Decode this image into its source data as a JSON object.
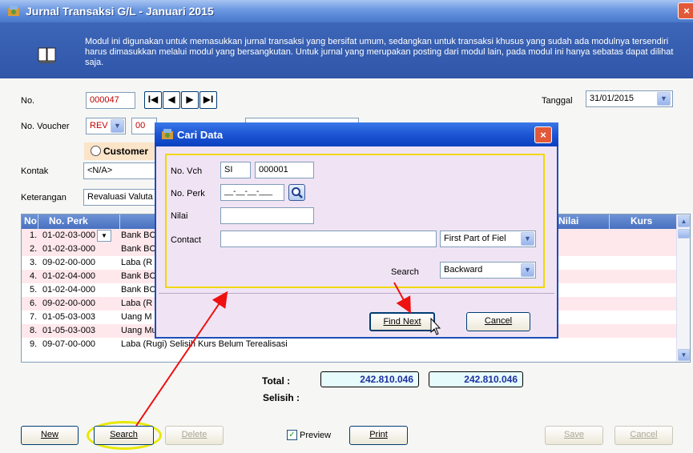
{
  "window": {
    "title": "Jurnal Transaksi G/L - Januari 2015",
    "close_glyph": "×"
  },
  "banner": {
    "text": "Modul ini digunakan untuk memasukkan jurnal transaksi yang bersifat umum, sedangkan untuk transaksi khusus yang sudah ada modulnya tersendiri harus dimasukkan melalui modul yang bersangkutan. Untuk jurnal yang merupakan posting dari modul lain, pada modul ini hanya sebatas dapat dilihat saja.",
    "icon": "book-icon"
  },
  "form": {
    "no_label": "No.",
    "no_value": "000047",
    "tanggal_label": "Tanggal",
    "tanggal_value": "31/01/2015",
    "voucher_label": "No. Voucher",
    "voucher_type": "REV",
    "voucher_number": "00",
    "customer_label": "Customer",
    "kontak_label": "Kontak",
    "kontak_value": "<N/A>",
    "keterangan_label": "Keterangan",
    "keterangan_value": "Revaluasi Valuta"
  },
  "nav": {
    "first": "I◀",
    "prev": "◀",
    "next": "▶",
    "last": "▶I"
  },
  "grid": {
    "columns": [
      "No",
      "No. Perk",
      "Nilai",
      "Kurs"
    ],
    "rows": [
      {
        "no": "1.",
        "perk": "01-02-03-000",
        "name": "Bank BC"
      },
      {
        "no": "2.",
        "perk": "01-02-03-000",
        "name": "Bank BC"
      },
      {
        "no": "3.",
        "perk": "09-02-00-000",
        "name": "Laba (R"
      },
      {
        "no": "4.",
        "perk": "01-02-04-000",
        "name": "Bank BC"
      },
      {
        "no": "5.",
        "perk": "01-02-04-000",
        "name": "Bank BC"
      },
      {
        "no": "6.",
        "perk": "09-02-00-000",
        "name": "Laba (R"
      },
      {
        "no": "7.",
        "perk": "01-05-03-003",
        "name": "Uang M"
      },
      {
        "no": "8.",
        "perk": "01-05-03-003",
        "name": "Uang Muka Pembelian EUR"
      },
      {
        "no": "9.",
        "perk": "09-07-00-000",
        "name": "Laba (Rugi) Selisih Kurs Belum Terealisasi"
      }
    ]
  },
  "totals": {
    "total_label": "Total :",
    "selisih_label": "Selisih :",
    "debit": "242.810.046",
    "credit": "242.810.046"
  },
  "buttons": {
    "new": "New",
    "search": "Search",
    "delete": "Delete",
    "preview": "Preview",
    "print": "Print",
    "save": "Save",
    "cancel": "Cancel"
  },
  "dialog": {
    "title": "Cari Data",
    "close_glyph": "×",
    "vch_label": "No. Vch",
    "vch_type": "SI",
    "vch_number": "000001",
    "perk_label": "No. Perk",
    "perk_mask": "__-__-__-___",
    "nilai_label": "Nilai",
    "nilai_value": "",
    "contact_label": "Contact",
    "contact_value": "",
    "contact_mode": "First Part of Fiel",
    "search_label": "Search",
    "search_direction": "Backward",
    "find_next": "Find Next",
    "cancel": "Cancel"
  },
  "colors": {
    "annotation_arrow": "#ee1111",
    "search_highlight": "#e8e800"
  }
}
